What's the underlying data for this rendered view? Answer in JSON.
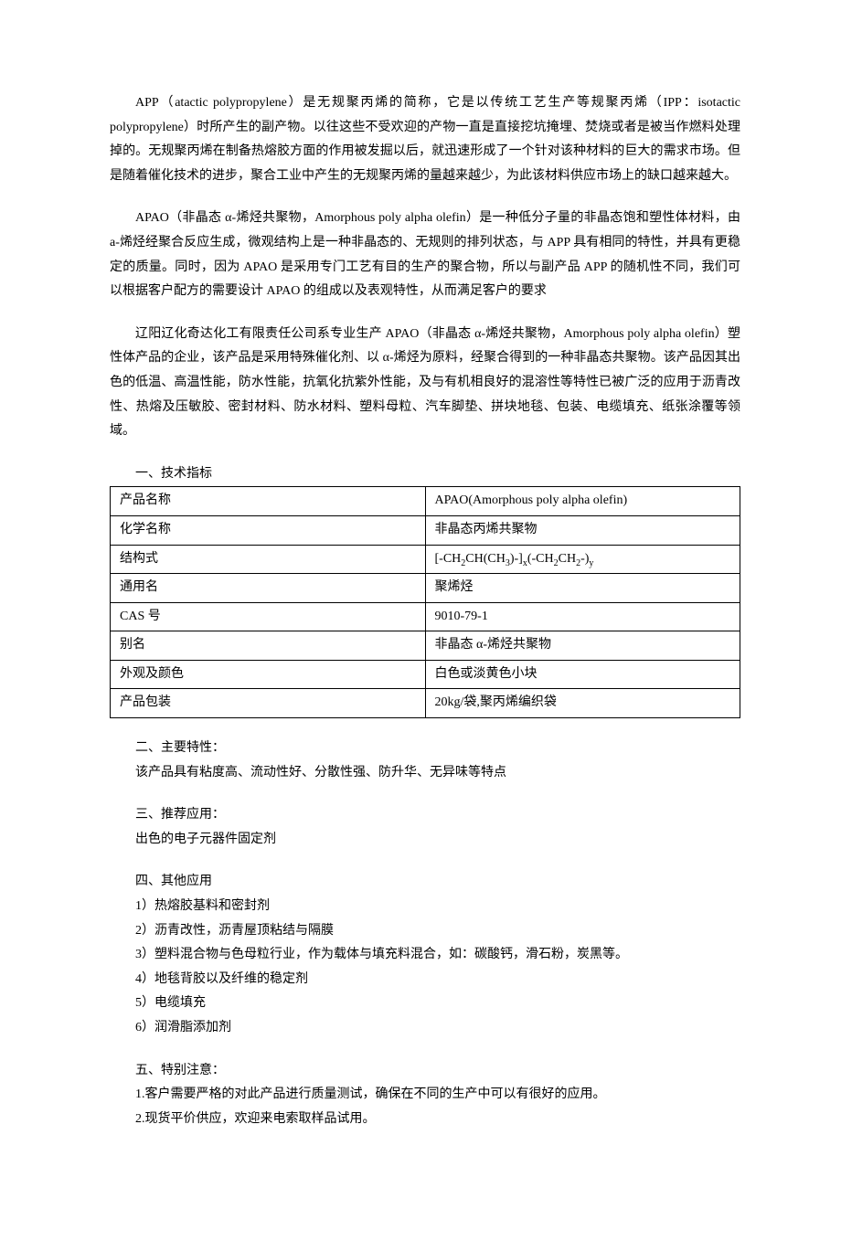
{
  "paragraphs": {
    "p1": "APP（atactic polypropylene）是无规聚丙烯的简称，它是以传统工艺生产等规聚丙烯（IPP：isotactic polypropylene）时所产生的副产物。以往这些不受欢迎的产物一直是直接挖坑掩埋、焚烧或者是被当作燃料处理掉的。无规聚丙烯在制备热熔胶方面的作用被发掘以后，就迅速形成了一个针对该种材料的巨大的需求市场。但是随着催化技术的进步，聚合工业中产生的无规聚丙烯的量越来越少，为此该材料供应市场上的缺口越来越大。",
    "p2": "APAO（非晶态 α-烯烃共聚物，Amorphous poly alpha olefin）是一种低分子量的非晶态饱和塑性体材料，由 a-烯烃经聚合反应生成，微观结构上是一种非晶态的、无规则的排列状态，与 APP 具有相同的特性，并具有更稳定的质量。同时，因为 APAO 是采用专门工艺有目的生产的聚合物，所以与副产品 APP 的随机性不同，我们可以根据客户配方的需要设计 APAO 的组成以及表观特性，从而满足客户的要求",
    "p3": "辽阳辽化奇达化工有限责任公司系专业生产 APAO（非晶态 α-烯烃共聚物，Amorphous poly alpha olefin）塑性体产品的企业，该产品是采用特殊催化剂、以 α-烯烃为原料，经聚合得到的一种非晶态共聚物。该产品因其出色的低温、高温性能，防水性能，抗氧化抗紫外性能，及与有机相良好的混溶性等特性已被广泛的应用于沥青改性、热熔及压敏胶、密封材料、防水材料、塑料母粒、汽车脚垫、拼块地毯、包装、电缆填充、纸张涂覆等领域。"
  },
  "section1": {
    "title": "一、技术指标",
    "rows": [
      {
        "label": "产品名称",
        "value_plain": "APAO(Amorphous poly alpha olefin)"
      },
      {
        "label": "化学名称",
        "value_plain": "非晶态丙烯共聚物"
      },
      {
        "label": "结构式",
        "value_html": "[-CH<sub>2</sub>CH(CH<sub>3</sub>)-]<sub>x</sub>(-CH<sub>2</sub>CH<sub>2</sub>-)<sub>y</sub>"
      },
      {
        "label": "通用名",
        "value_plain": "聚烯烃"
      },
      {
        "label": "CAS 号",
        "value_plain": "9010-79-1"
      },
      {
        "label": "别名",
        "value_plain": "非晶态 α-烯烃共聚物"
      },
      {
        "label": "外观及颜色",
        "value_plain": "白色或淡黄色小块"
      },
      {
        "label": "产品包装",
        "value_plain": "20kg/袋,聚丙烯编织袋"
      }
    ]
  },
  "section2": {
    "title": "二、主要特性：",
    "body": "该产品具有粘度高、流动性好、分散性强、防升华、无异味等特点"
  },
  "section3": {
    "title": "三、推荐应用：",
    "body": "出色的电子元器件固定剂"
  },
  "section4": {
    "title": "四、其他应用",
    "items": [
      "1）热熔胶基料和密封剂",
      "2）沥青改性，沥青屋顶粘结与隔膜",
      "3）塑料混合物与色母粒行业，作为载体与填充料混合，如：碳酸钙，滑石粉，炭黑等。",
      "4）地毯背胶以及纤维的稳定剂",
      "5）电缆填充",
      "6）润滑脂添加剂"
    ]
  },
  "section5": {
    "title": "五、特别注意：",
    "items": [
      "1.客户需要严格的对此产品进行质量测试，确保在不同的生产中可以有很好的应用。",
      "2.现货平价供应，欢迎来电索取样品试用。"
    ]
  }
}
